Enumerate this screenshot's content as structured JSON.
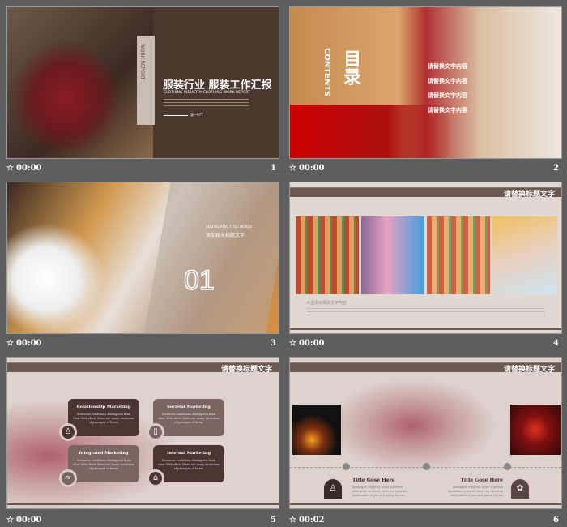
{
  "slides": [
    {
      "number": "1",
      "time": "00:00",
      "title": "服装行业 服装工作汇报",
      "subtitle": "CLOTHING INDUSTRY CLOTHING WORK REPORT",
      "side_label": "WORK REPORT",
      "footer": "第一97T"
    },
    {
      "number": "2",
      "time": "00:00",
      "heading": "目录",
      "heading_en": "CONTENTS",
      "items": [
        "请替换文字内容",
        "请替换文字内容",
        "请替换文字内容",
        "请替换文字内容"
      ]
    },
    {
      "number": "3",
      "time": "00:00",
      "caption_en": "ADD RELATED TITLE WORDS",
      "caption": "添加相关标题文字",
      "section": "01"
    },
    {
      "number": "4",
      "time": "00:00",
      "bar_title": "请替换标题文字",
      "text_title": "点击添加相关文字内容"
    },
    {
      "number": "5",
      "time": "00:00",
      "bar_title": "请替换标题文字",
      "cards": [
        {
          "title": "Relationship Marketing",
          "icon": "people-icon"
        },
        {
          "title": "Societal Marketing",
          "icon": "device-icon"
        },
        {
          "title": "Integrated Marketing",
          "icon": "chart-icon"
        },
        {
          "title": "Internal Marketing",
          "icon": "home-icon"
        }
      ],
      "card_text": "Generous conditions distinguish from clear Web alerts there are many variations of passages of lorem"
    },
    {
      "number": "6",
      "time": "00:02",
      "bar_title": "请替换标题文字",
      "blocks": [
        {
          "title": "Title Gose Here",
          "text": "passages majority have suffered alteration in some form, by injected believable. If you are going to use"
        },
        {
          "title": "Title Gose Here",
          "text": "passages majority have suffered alteration in some form, by injected believable. If you are going to use"
        }
      ]
    }
  ],
  "star_icon": "☆"
}
